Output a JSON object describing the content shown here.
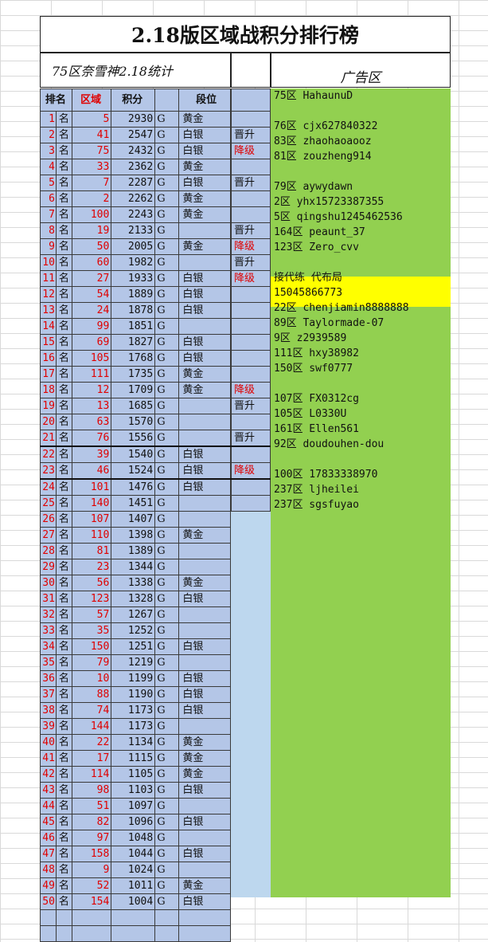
{
  "title": "2.18版区域战积分排行榜",
  "subtitle": "75区奈雪神2.18统计",
  "ad_header": "广告区",
  "headers": {
    "rank": "排名",
    "zone": "区域",
    "score": "积分",
    "tier": "段位"
  },
  "ming": "名",
  "grade": "G",
  "rows": [
    {
      "rank": "1",
      "zone": "5",
      "score": "2930",
      "tier": "黄金",
      "status": ""
    },
    {
      "rank": "2",
      "zone": "41",
      "score": "2547",
      "tier": "白银",
      "status": "晋升"
    },
    {
      "rank": "3",
      "zone": "75",
      "score": "2432",
      "tier": "白银",
      "status": "降级"
    },
    {
      "rank": "4",
      "zone": "33",
      "score": "2362",
      "tier": "黄金",
      "status": ""
    },
    {
      "rank": "5",
      "zone": "7",
      "score": "2287",
      "tier": "白银",
      "status": "晋升"
    },
    {
      "rank": "6",
      "zone": "2",
      "score": "2262",
      "tier": "黄金",
      "status": ""
    },
    {
      "rank": "7",
      "zone": "100",
      "score": "2243",
      "tier": "黄金",
      "status": ""
    },
    {
      "rank": "8",
      "zone": "19",
      "score": "2133",
      "tier": "",
      "status": "晋升"
    },
    {
      "rank": "9",
      "zone": "50",
      "score": "2005",
      "tier": "黄金",
      "status": "降级"
    },
    {
      "rank": "10",
      "zone": "60",
      "score": "1982",
      "tier": "",
      "status": "晋升"
    },
    {
      "rank": "11",
      "zone": "27",
      "score": "1933",
      "tier": "白银",
      "status": "降级"
    },
    {
      "rank": "12",
      "zone": "54",
      "score": "1889",
      "tier": "白银",
      "status": ""
    },
    {
      "rank": "13",
      "zone": "24",
      "score": "1878",
      "tier": "白银",
      "status": ""
    },
    {
      "rank": "14",
      "zone": "99",
      "score": "1851",
      "tier": "",
      "status": ""
    },
    {
      "rank": "15",
      "zone": "69",
      "score": "1827",
      "tier": "白银",
      "status": ""
    },
    {
      "rank": "16",
      "zone": "105",
      "score": "1768",
      "tier": "白银",
      "status": ""
    },
    {
      "rank": "17",
      "zone": "111",
      "score": "1735",
      "tier": "黄金",
      "status": ""
    },
    {
      "rank": "18",
      "zone": "12",
      "score": "1709",
      "tier": "黄金",
      "status": "降级"
    },
    {
      "rank": "19",
      "zone": "13",
      "score": "1685",
      "tier": "",
      "status": "晋升"
    },
    {
      "rank": "20",
      "zone": "63",
      "score": "1570",
      "tier": "",
      "status": ""
    },
    {
      "rank": "21",
      "zone": "76",
      "score": "1556",
      "tier": "",
      "status": "晋升"
    },
    {
      "rank": "22",
      "zone": "39",
      "score": "1540",
      "tier": "白银",
      "status": ""
    },
    {
      "rank": "23",
      "zone": "46",
      "score": "1524",
      "tier": "白银",
      "status": "降级"
    },
    {
      "rank": "24",
      "zone": "101",
      "score": "1476",
      "tier": "白银",
      "status": ""
    },
    {
      "rank": "25",
      "zone": "140",
      "score": "1451",
      "tier": "",
      "status": ""
    },
    {
      "rank": "26",
      "zone": "107",
      "score": "1407",
      "tier": "",
      "status": ""
    },
    {
      "rank": "27",
      "zone": "110",
      "score": "1398",
      "tier": "黄金",
      "status": ""
    },
    {
      "rank": "28",
      "zone": "81",
      "score": "1389",
      "tier": "",
      "status": ""
    },
    {
      "rank": "29",
      "zone": "23",
      "score": "1344",
      "tier": "",
      "status": ""
    },
    {
      "rank": "30",
      "zone": "56",
      "score": "1338",
      "tier": "黄金",
      "status": ""
    },
    {
      "rank": "31",
      "zone": "123",
      "score": "1328",
      "tier": "白银",
      "status": ""
    },
    {
      "rank": "32",
      "zone": "57",
      "score": "1267",
      "tier": "",
      "status": ""
    },
    {
      "rank": "33",
      "zone": "35",
      "score": "1252",
      "tier": "",
      "status": ""
    },
    {
      "rank": "34",
      "zone": "150",
      "score": "1251",
      "tier": "白银",
      "status": ""
    },
    {
      "rank": "35",
      "zone": "79",
      "score": "1219",
      "tier": "",
      "status": ""
    },
    {
      "rank": "36",
      "zone": "10",
      "score": "1199",
      "tier": "白银",
      "status": ""
    },
    {
      "rank": "37",
      "zone": "88",
      "score": "1190",
      "tier": "白银",
      "status": ""
    },
    {
      "rank": "38",
      "zone": "74",
      "score": "1173",
      "tier": "白银",
      "status": ""
    },
    {
      "rank": "39",
      "zone": "144",
      "score": "1173",
      "tier": "",
      "status": ""
    },
    {
      "rank": "40",
      "zone": "22",
      "score": "1134",
      "tier": "黄金",
      "status": ""
    },
    {
      "rank": "41",
      "zone": "17",
      "score": "1115",
      "tier": "黄金",
      "status": ""
    },
    {
      "rank": "42",
      "zone": "114",
      "score": "1105",
      "tier": "黄金",
      "status": ""
    },
    {
      "rank": "43",
      "zone": "98",
      "score": "1103",
      "tier": "白银",
      "status": ""
    },
    {
      "rank": "44",
      "zone": "51",
      "score": "1097",
      "tier": "",
      "status": ""
    },
    {
      "rank": "45",
      "zone": "82",
      "score": "1096",
      "tier": "白银",
      "status": ""
    },
    {
      "rank": "46",
      "zone": "97",
      "score": "1048",
      "tier": "",
      "status": ""
    },
    {
      "rank": "47",
      "zone": "158",
      "score": "1044",
      "tier": "白银",
      "status": ""
    },
    {
      "rank": "48",
      "zone": "9",
      "score": "1024",
      "tier": "",
      "status": ""
    },
    {
      "rank": "49",
      "zone": "52",
      "score": "1011",
      "tier": "黄金",
      "status": ""
    },
    {
      "rank": "50",
      "zone": "154",
      "score": "1004",
      "tier": "白银",
      "status": ""
    }
  ],
  "ads": [
    {
      "slot": 0,
      "text": "75区  HahaunuD"
    },
    {
      "slot": 2,
      "text": "76区  cjx627840322"
    },
    {
      "slot": 3,
      "text": "83区  zhaohaoaooz"
    },
    {
      "slot": 4,
      "text": "81区  zouzheng914"
    },
    {
      "slot": 6,
      "text": "79区  aywydawn"
    },
    {
      "slot": 7,
      "text": "2区   yhx15723387355"
    },
    {
      "slot": 8,
      "text": "5区   qingshu1245462536"
    },
    {
      "slot": 9,
      "text": "164区 peaunt_37"
    },
    {
      "slot": 10,
      "text": "123区 Zero_cvv"
    },
    {
      "slot": 12,
      "text": "接代练 代布局"
    },
    {
      "slot": 13,
      "text": "15045866773"
    },
    {
      "slot": 14,
      "text": "22区  chenjiamin8888888"
    },
    {
      "slot": 15,
      "text": "89区  Taylormade-07"
    },
    {
      "slot": 16,
      "text": "9区   z2939589"
    },
    {
      "slot": 17,
      "text": "111区 hxy38982"
    },
    {
      "slot": 18,
      "text": "150区 swf0777"
    },
    {
      "slot": 20,
      "text": "107区 FX0312cg"
    },
    {
      "slot": 21,
      "text": "105区 L0330U"
    },
    {
      "slot": 22,
      "text": "161区 Ellen561"
    },
    {
      "slot": 23,
      "text": "92区  doudouhen-dou"
    },
    {
      "slot": 25,
      "text": "100区  17833338970"
    },
    {
      "slot": 26,
      "text": "237区  ljheilei"
    },
    {
      "slot": 27,
      "text": "237区  sgsfuyao"
    }
  ],
  "colors": {
    "ranking_bg": "#b4c6e7",
    "ad_bg": "#92d050",
    "highlight": "#ffff00",
    "red": "#e00000"
  }
}
